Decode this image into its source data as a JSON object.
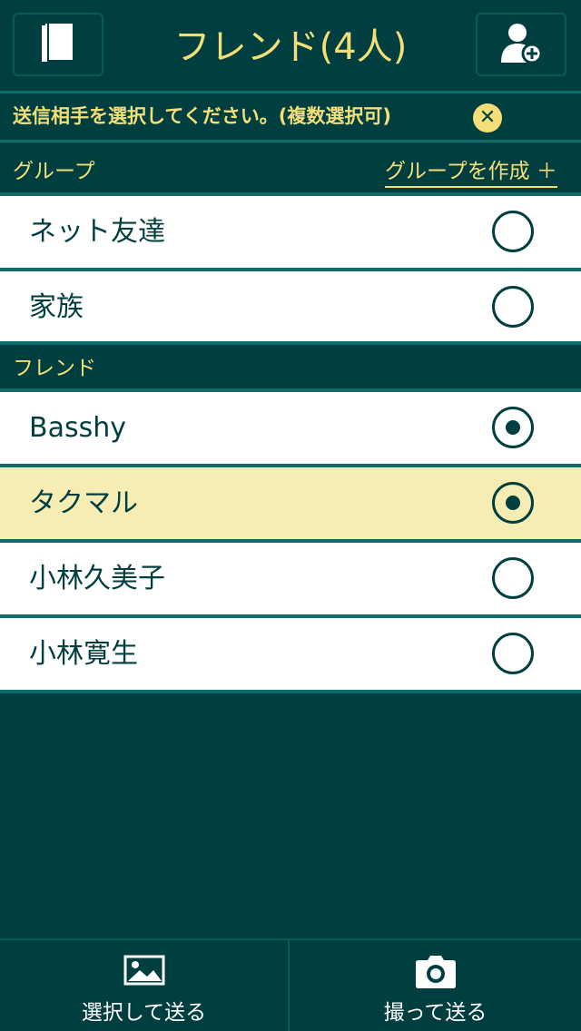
{
  "header": {
    "title": "フレンド(4人)",
    "left_icon": "book-icon",
    "right_icon": "add-user-icon"
  },
  "notice": {
    "text": "送信相手を選択してください。(複数選択可)",
    "close_icon": "close-icon",
    "close_glyph": "✕"
  },
  "groups": {
    "label": "グループ",
    "create_label": "グループを作成 ＋",
    "items": [
      {
        "label": "ネット友達",
        "selected": false
      },
      {
        "label": "家族",
        "selected": false
      }
    ]
  },
  "friends": {
    "label": "フレンド",
    "items": [
      {
        "label": "Basshy",
        "selected": true
      },
      {
        "label": "タクマル",
        "selected": true
      },
      {
        "label": "小林久美子",
        "selected": false
      },
      {
        "label": "小林寛生",
        "selected": false
      }
    ]
  },
  "bottom": {
    "select_send_label": "選択して送る",
    "select_send_icon": "image-icon",
    "shoot_send_label": "撮って送る",
    "shoot_send_icon": "camera-icon"
  },
  "colors": {
    "background": "#003e3f",
    "accent": "#f3de78",
    "highlight": "#f6edb5",
    "divider": "#0d6b6a"
  }
}
